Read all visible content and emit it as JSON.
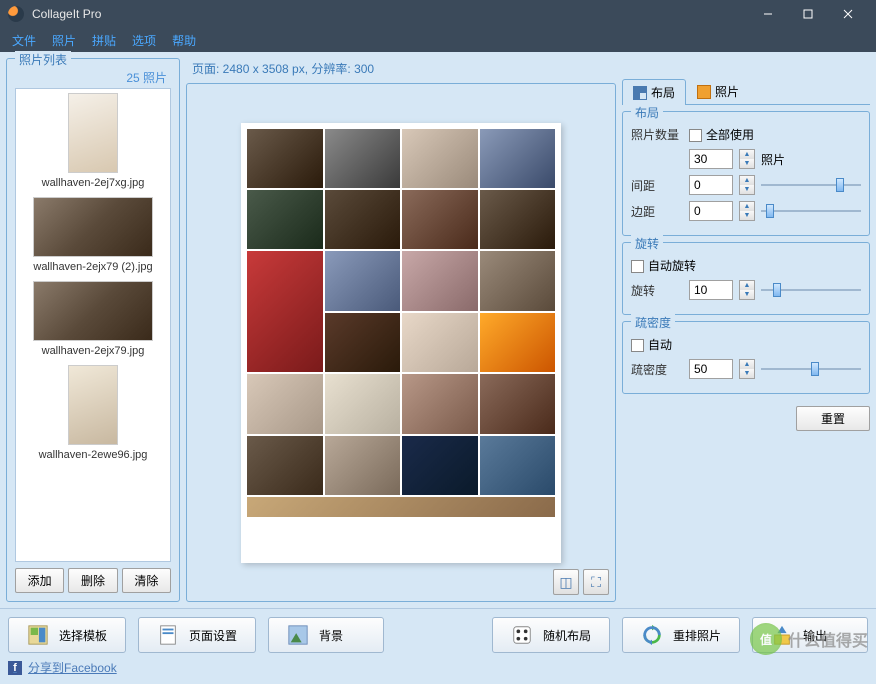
{
  "app": {
    "title": "CollageIt Pro"
  },
  "menu": [
    "文件",
    "照片",
    "拼贴",
    "选项",
    "帮助"
  ],
  "photo_list": {
    "title": "照片列表",
    "count_label": "25 照片",
    "items": [
      {
        "file": "wallhaven-2ej7xg.jpg",
        "variant": "person"
      },
      {
        "file": "wallhaven-2ejx79 (2).jpg",
        "variant": "wide"
      },
      {
        "file": "wallhaven-2ejx79.jpg",
        "variant": "wide"
      },
      {
        "file": "wallhaven-2ewe96.jpg",
        "variant": "tall"
      }
    ],
    "buttons": {
      "add": "添加",
      "delete": "删除",
      "clear": "清除"
    }
  },
  "page_info": "页面: 2480 x 3508 px, 分辨率: 300",
  "tabs": {
    "layout": "布局",
    "photo": "照片"
  },
  "layout_group": {
    "title": "布局",
    "photo_count_label": "照片数量",
    "use_all_label": "全部使用",
    "photo_count_value": "30",
    "photo_unit": "照片",
    "spacing_label": "间距",
    "spacing_value": "0",
    "margin_label": "边距",
    "margin_value": "0"
  },
  "rotate_group": {
    "title": "旋转",
    "auto_label": "自动旋转",
    "rotate_label": "旋转",
    "rotate_value": "10"
  },
  "density_group": {
    "title": "疏密度",
    "auto_label": "自动",
    "density_label": "疏密度",
    "density_value": "50"
  },
  "reset_label": "重置",
  "big_buttons": {
    "template": "选择模板",
    "page": "页面设置",
    "bg": "背景",
    "random": "随机布局",
    "rearrange": "重排照片",
    "output": "输出"
  },
  "fb_label": "分享到Facebook",
  "watermark": {
    "badge": "值",
    "text": "什么值得买"
  }
}
